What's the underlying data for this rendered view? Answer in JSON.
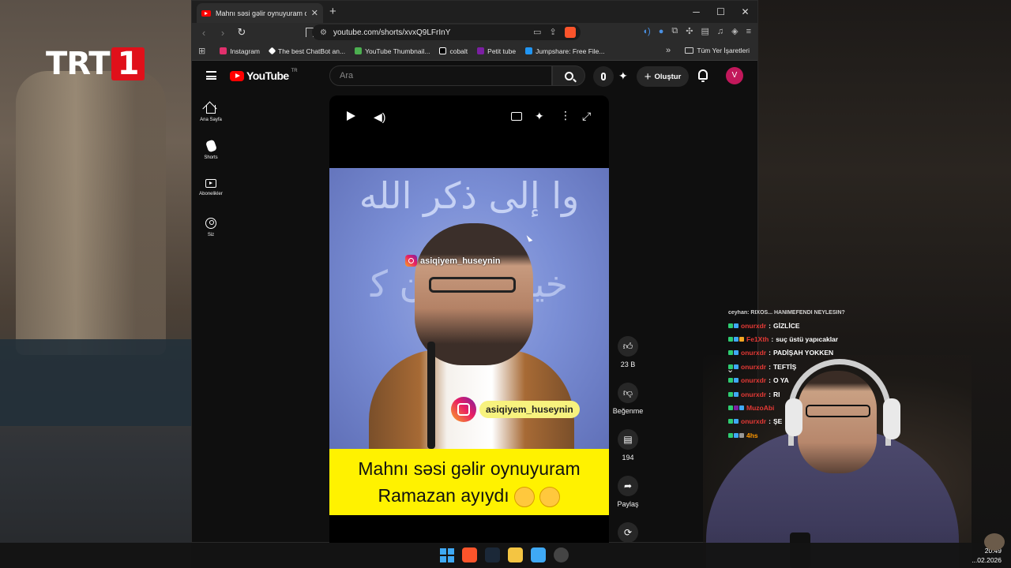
{
  "overlay": {
    "channel_logo_text": "TRT",
    "channel_logo_num": "1"
  },
  "browser": {
    "tab_title": "Mahnı səsi gəlir oynuyuram oruc",
    "url": "youtube.com/shorts/xvxQ9LFrInY",
    "bookmarks": [
      {
        "label": "Instagram",
        "color": "#e1306c"
      },
      {
        "label": "The best ChatBot an...",
        "color": "#ffffff"
      },
      {
        "label": "YouTube Thumbnail...",
        "color": "#4caf50"
      },
      {
        "label": "cobalt",
        "color": "#ffffff"
      },
      {
        "label": "Petit tube",
        "color": "#7b1fa2"
      },
      {
        "label": "Jumpshare: Free File...",
        "color": "#2196f3"
      }
    ],
    "all_bookmarks_label": "Tüm Yer İşaretleri"
  },
  "youtube": {
    "logo_text": "YouTube",
    "logo_region": "TR",
    "search_placeholder": "Ara",
    "create_label": "Oluştur",
    "avatar_initial": "V",
    "sidebar": [
      {
        "label": "Ana Sayfa",
        "icon": "home-icon"
      },
      {
        "label": "Shorts",
        "icon": "shorts-icon"
      },
      {
        "label": "Abonelikler",
        "icon": "subscriptions-icon"
      },
      {
        "label": "Siz",
        "icon": "you-icon"
      }
    ],
    "video": {
      "arabic_top": "ﻭﺍ ﺇﻟﻰ ﺫﻛﺮ ﺍﻟﻠﻪ",
      "arabic_mid": "ﺧﻴﺮ ﻟﻜﻢ ﺇﻥ ﻛ",
      "instagram_handle_top": "asiqiyem_huseynin",
      "instagram_handle_bottom": "asiqiyem_huseynin",
      "caption_line1": "Mahnı səsi gəlir oynuyuram",
      "caption_line2": "Ramazan ayıydı"
    },
    "actions": {
      "likes": "23 B",
      "dislike_label": "Beğenme",
      "comments": "194",
      "share_label": "Paylaş"
    }
  },
  "chat": {
    "top_line": "ceyhan: RIXOS... HANIMEFENDI NEYLESIN?",
    "messages": [
      {
        "user": "onurxdr",
        "text": "GİZLİCE",
        "user_color": "#e53935"
      },
      {
        "user": "Fe1Xth",
        "text": "suç üstü yapıcaklar",
        "user_color": "#e53935"
      },
      {
        "user": "onurxdr",
        "text": "PADİŞAH YOKKEN",
        "user_color": "#e53935"
      },
      {
        "user": "onurxdr",
        "text": "TEFTİŞ",
        "user_color": "#e53935"
      },
      {
        "user": "onurxdr",
        "text": "O YA",
        "user_color": "#e53935"
      },
      {
        "user": "onurxdr",
        "text": "RI",
        "user_color": "#e53935"
      },
      {
        "user": "MuzoAbi",
        "text": "",
        "user_color": "#e53935"
      },
      {
        "user": "onurxdr",
        "text": "ŞE",
        "user_color": "#e53935"
      },
      {
        "user": "4hs",
        "text": "",
        "user_color": "#ff9800"
      }
    ]
  },
  "taskbar": {
    "time": "20:49",
    "date": "...02.2026"
  }
}
